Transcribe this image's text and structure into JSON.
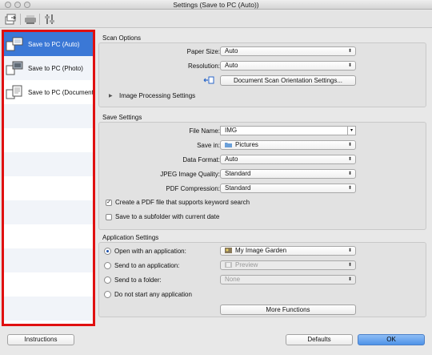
{
  "window": {
    "title": "Settings (Save to PC (Auto))"
  },
  "toolbar": {
    "icons": [
      "scan-from-computer-icon",
      "scan-from-panel-icon",
      "general-settings-icon"
    ]
  },
  "sidebar": {
    "items": [
      {
        "label": "Save to PC (Auto)",
        "selected": true
      },
      {
        "label": "Save to PC (Photo)",
        "selected": false
      },
      {
        "label": "Save to PC (Document)",
        "selected": false
      }
    ]
  },
  "scan_options": {
    "title": "Scan Options",
    "paper_size_label": "Paper Size:",
    "paper_size_value": "Auto",
    "resolution_label": "Resolution:",
    "resolution_value": "Auto",
    "orientation_button": "Document Scan Orientation Settings...",
    "image_processing_label": "Image Processing Settings"
  },
  "save_settings": {
    "title": "Save Settings",
    "file_name_label": "File Name:",
    "file_name_value": "IMG",
    "save_in_label": "Save in:",
    "save_in_value": "Pictures",
    "data_format_label": "Data Format:",
    "data_format_value": "Auto",
    "jpeg_quality_label": "JPEG Image Quality:",
    "jpeg_quality_value": "Standard",
    "pdf_compression_label": "PDF Compression:",
    "pdf_compression_value": "Standard",
    "keyword_pdf_label": "Create a PDF file that supports keyword search",
    "keyword_pdf_checked": true,
    "subfolder_label": "Save to a subfolder with current date",
    "subfolder_checked": false
  },
  "application_settings": {
    "title": "Application Settings",
    "open_app_label": "Open with an application:",
    "open_app_value": "My Image Garden",
    "send_app_label": "Send to an application:",
    "send_app_value": "Preview",
    "send_folder_label": "Send to a folder:",
    "send_folder_value": "None",
    "no_app_label": "Do not start any application",
    "selected_option": "open_app",
    "more_functions_button": "More Functions"
  },
  "footer": {
    "instructions_button": "Instructions",
    "defaults_button": "Defaults",
    "ok_button": "OK"
  },
  "colors": {
    "selection": "#3b78d6",
    "highlight_border": "#e01010",
    "ok_button": "#4f93e8"
  }
}
